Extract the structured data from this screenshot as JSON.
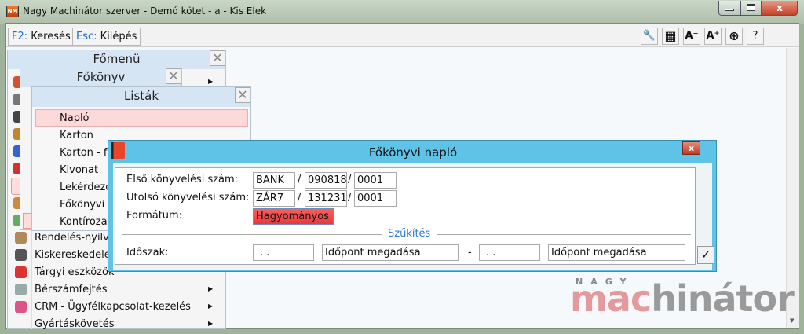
{
  "window": {
    "title": "Nagy Machinátor szerver - Demó kötet - a - Kis Elek",
    "app_icon": "NM",
    "close_glyph": "x"
  },
  "toolbar": {
    "buttons": [
      {
        "key": "F2:",
        "label": "Keresés"
      },
      {
        "key": "Esc:",
        "label": "Kilépés"
      }
    ],
    "icon_buttons": [
      {
        "icon": "wrench-icon",
        "glyph": "🔧"
      },
      {
        "icon": "grid-icon",
        "glyph": "▦"
      },
      {
        "icon": "font-decrease-icon",
        "glyph": "A⁻"
      },
      {
        "icon": "font-increase-icon",
        "glyph": "A⁺"
      },
      {
        "icon": "lifebuoy-icon",
        "glyph": "⊕"
      },
      {
        "icon": "help-icon",
        "glyph": "?"
      }
    ]
  },
  "fomenu": {
    "title": "Főmenü",
    "items": [
      "Rendelés-nyilvántartás",
      "Kiskereskedelem",
      "Tárgyi eszközök",
      "Bérszámfejtés",
      "CRM - Ügyfélkapcsolat-kezelés",
      "Gyártáskövetés"
    ]
  },
  "fokonyv": {
    "title": "Főkönyv"
  },
  "listak": {
    "title": "Listák",
    "items": [
      "Napló",
      "Karton",
      "Karton - f",
      "Kivonat",
      "Lekérdező",
      "Főkönyvi",
      "Kontírozat"
    ]
  },
  "dialog": {
    "title": "Főkönyvi napló",
    "close_glyph": "x",
    "first_label": "Első könyvelési szám:",
    "first": [
      "BANK",
      "090818",
      "0001"
    ],
    "last_label": "Utolsó könyvelési szám:",
    "last": [
      "ZÁR7",
      "131231",
      "0001"
    ],
    "slash": "/",
    "format_label": "Formátum:",
    "format_value": "Hagyományos",
    "section": "Szűkítés",
    "period_label": "Időszak:",
    "period_from_date": ". .",
    "period_from_time": "Időpont megadása",
    "dash": "-",
    "period_to_date": ". .",
    "period_to_time": "Időpont megadása",
    "ok_glyph": "✓"
  },
  "logo": {
    "top": "NAGY",
    "red": "mac",
    "gray": "hinátor"
  },
  "colors": {
    "dialog_title": "#5ec3e6",
    "selected_item": "#fdd9d9",
    "format_field": "#f04848",
    "link_key": "#1a6fd0"
  }
}
